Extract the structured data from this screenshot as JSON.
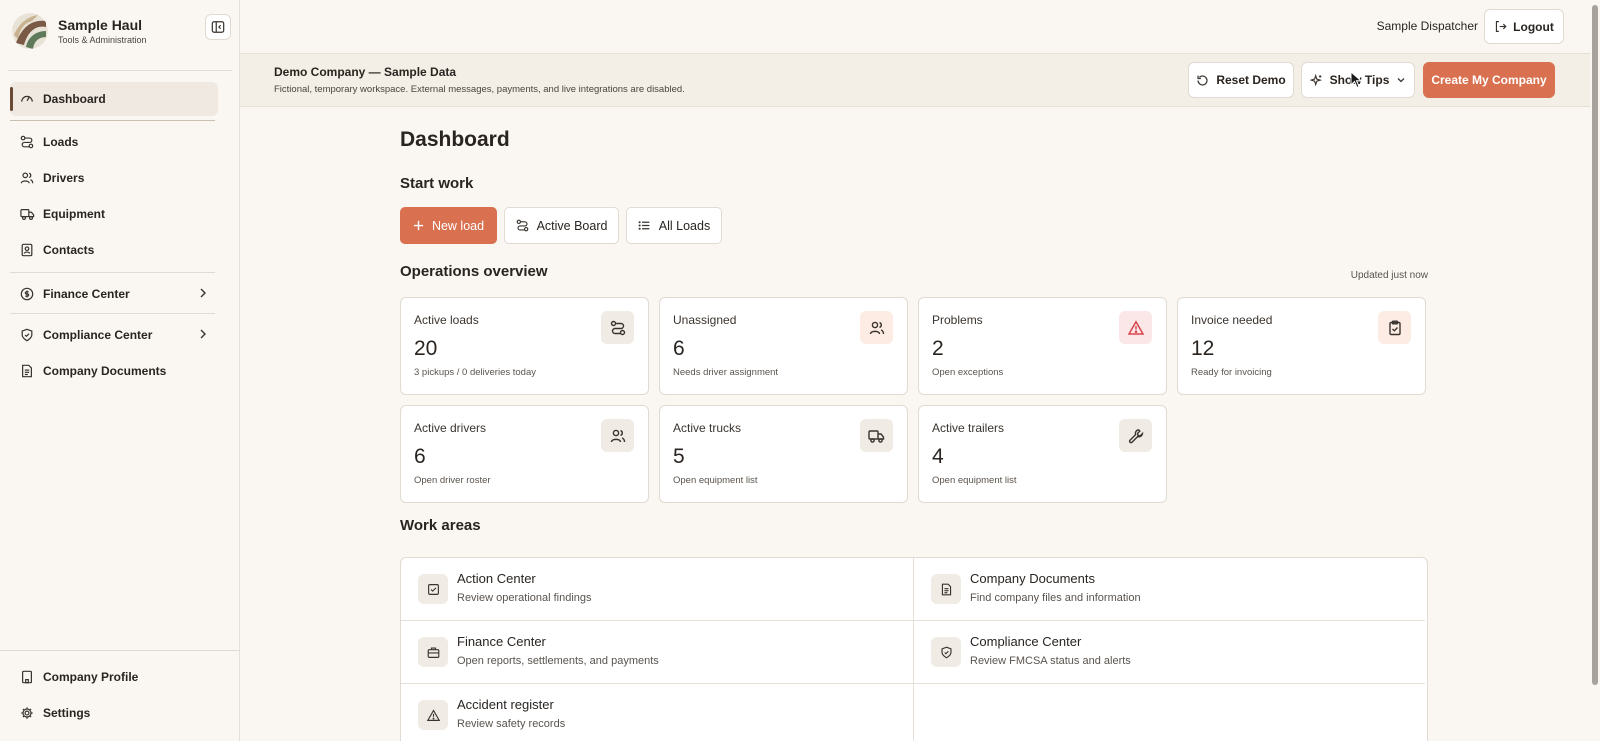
{
  "brand": {
    "name": "Sample Haul",
    "subtitle": "Tools & Administration"
  },
  "sidebar": {
    "items": [
      {
        "label": "Dashboard",
        "icon": "gauge-icon"
      },
      {
        "label": "Loads",
        "icon": "route-icon"
      },
      {
        "label": "Drivers",
        "icon": "users-icon"
      },
      {
        "label": "Equipment",
        "icon": "truck-icon"
      },
      {
        "label": "Contacts",
        "icon": "contact-book-icon"
      },
      {
        "label": "Finance Center",
        "icon": "dollar-circle-icon"
      },
      {
        "label": "Compliance Center",
        "icon": "shield-icon"
      },
      {
        "label": "Company Documents",
        "icon": "document-icon"
      }
    ],
    "bottom_items": [
      {
        "label": "Company Profile",
        "icon": "building-icon"
      },
      {
        "label": "Settings",
        "icon": "gear-icon"
      }
    ]
  },
  "header": {
    "user": "Sample Dispatcher",
    "logout_label": "Logout"
  },
  "banner": {
    "title": "Demo Company — Sample Data",
    "subtitle": "Fictional, temporary workspace. External messages, payments, and live integrations are disabled.",
    "reset_label": "Reset Demo",
    "tips_label": "Show Tips",
    "create_label": "Create My Company"
  },
  "main": {
    "title": "Dashboard",
    "start_work": {
      "title": "Start work",
      "new_load": "New load",
      "active_board": "Active Board",
      "all_loads": "All Loads"
    },
    "overview": {
      "title": "Operations overview",
      "updated": "Updated just now",
      "cards": [
        {
          "label": "Active loads",
          "value": "20",
          "sub": "3 pickups / 0 deliveries today",
          "icon": "route-icon"
        },
        {
          "label": "Unassigned",
          "value": "6",
          "sub": "Needs driver assignment",
          "icon": "users-icon"
        },
        {
          "label": "Problems",
          "value": "2",
          "sub": "Open exceptions",
          "icon": "warning-icon"
        },
        {
          "label": "Invoice needed",
          "value": "12",
          "sub": "Ready for invoicing",
          "icon": "clipboard-check-icon"
        },
        {
          "label": "Active drivers",
          "value": "6",
          "sub": "Open driver roster",
          "icon": "users-icon"
        },
        {
          "label": "Active trucks",
          "value": "5",
          "sub": "Open equipment list",
          "icon": "truck-icon"
        },
        {
          "label": "Active trailers",
          "value": "4",
          "sub": "Open equipment list",
          "icon": "wrench-icon"
        }
      ]
    },
    "work_areas": {
      "title": "Work areas",
      "items": [
        {
          "title": "Action Center",
          "sub": "Review operational findings",
          "icon": "checkbox-icon"
        },
        {
          "title": "Company Documents",
          "sub": "Find company files and information",
          "icon": "document-icon"
        },
        {
          "title": "Finance Center",
          "sub": "Open reports, settlements, and payments",
          "icon": "briefcase-icon"
        },
        {
          "title": "Compliance Center",
          "sub": "Review FMCSA status and alerts",
          "icon": "shield-icon"
        },
        {
          "title": "Accident register",
          "sub": "Review safety records",
          "icon": "warning-icon"
        }
      ]
    }
  },
  "colors": {
    "accent": "#d9704f",
    "problem": "#d9434a",
    "background": "#faf7f2"
  }
}
